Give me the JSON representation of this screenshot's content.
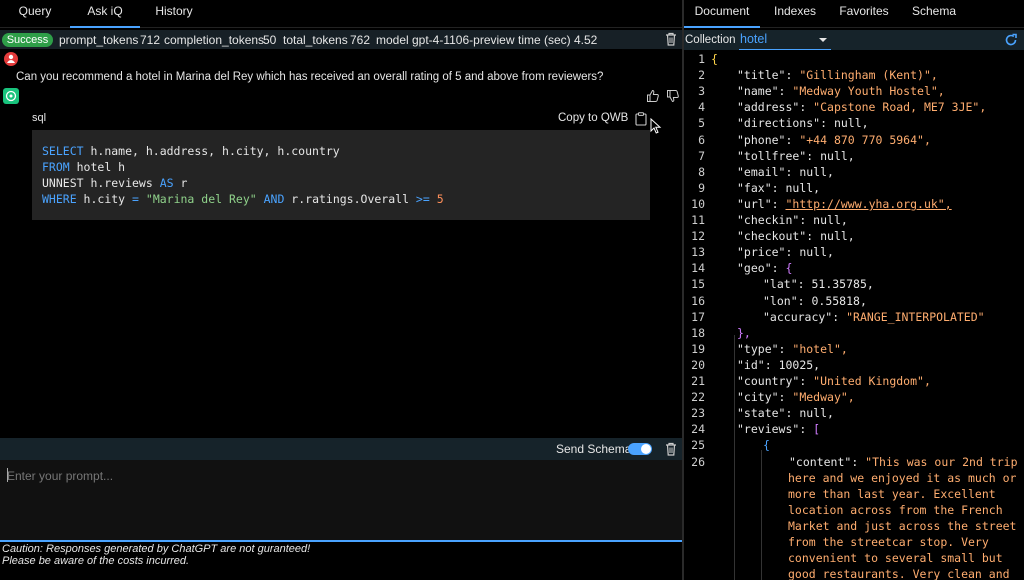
{
  "left_tabs": [
    "Query",
    "Ask iQ",
    "History"
  ],
  "status": {
    "badge": "Success",
    "prompt_tokens_label": "prompt_tokens",
    "prompt_tokens": "712",
    "completion_tokens_label": "completion_tokens",
    "completion_tokens": "50",
    "total_tokens_label": "total_tokens",
    "total_tokens": "762",
    "model_label": "model",
    "model": "gpt-4-1106-preview",
    "time_label": "time (sec)",
    "time": "4.52"
  },
  "chat": {
    "question": "Can you recommend a hotel in Marina del Rey which has received an overall rating of 5 and above from reviewers?",
    "code_lang": "sql",
    "copy_label": "Copy to QWB",
    "sql": {
      "l1_kw": "SELECT",
      "l1_rest": " h.name, h.address, h.city, h.country",
      "l2_kw": "FROM",
      "l2_rest": " hotel h",
      "l3_a": "UNNEST h.reviews ",
      "l3_kw": "AS",
      "l3_rest": " r",
      "l4_kw": "WHERE",
      "l4_a": " h.city ",
      "l4_eq": "=",
      "l4_str": "\"Marina del Rey\"",
      "l4_and": " AND ",
      "l4_b": "r.ratings.Overall ",
      "l4_ge": ">=",
      "l4_num": "5"
    }
  },
  "schema_toggle_label": "Send Schema",
  "prompt_placeholder": "Enter your prompt...",
  "caution_line1": "Caution: Responses generated by ChatGPT are not guranteed!",
  "caution_line2": "Please be aware of the costs incurred.",
  "right_tabs": [
    "Document",
    "Indexes",
    "Favorites",
    "Schema"
  ],
  "collection_label": "Collection",
  "collection_value": "hotel",
  "json_lines": [
    {
      "n": "1",
      "k": "",
      "v": "{"
    },
    {
      "n": "2",
      "k": "\"title\"",
      "v": "\"Gillingham (Kent)\","
    },
    {
      "n": "3",
      "k": "\"name\"",
      "v": "\"Medway Youth Hostel\","
    },
    {
      "n": "4",
      "k": "\"address\"",
      "v": "\"Capstone Road, ME7 3JE\","
    },
    {
      "n": "5",
      "k": "\"directions\"",
      "v": "null,"
    },
    {
      "n": "6",
      "k": "\"phone\"",
      "v": "\"+44 870 770 5964\","
    },
    {
      "n": "7",
      "k": "\"tollfree\"",
      "v": "null,"
    },
    {
      "n": "8",
      "k": "\"email\"",
      "v": "null,"
    },
    {
      "n": "9",
      "k": "\"fax\"",
      "v": "null,"
    },
    {
      "n": "10",
      "k": "\"url\"",
      "v": "\"http://www.yha.org.uk\","
    },
    {
      "n": "11",
      "k": "\"checkin\"",
      "v": "null,"
    },
    {
      "n": "12",
      "k": "\"checkout\"",
      "v": "null,"
    },
    {
      "n": "13",
      "k": "\"price\"",
      "v": "null,"
    },
    {
      "n": "14",
      "k": "\"geo\"",
      "v": "{"
    },
    {
      "n": "15",
      "k": "\"lat\"",
      "v": "51.35785,"
    },
    {
      "n": "16",
      "k": "\"lon\"",
      "v": "0.55818,"
    },
    {
      "n": "17",
      "k": "\"accuracy\"",
      "v": "\"RANGE_INTERPOLATED\""
    },
    {
      "n": "18",
      "k": "",
      "v": "},"
    },
    {
      "n": "19",
      "k": "\"type\"",
      "v": "\"hotel\","
    },
    {
      "n": "20",
      "k": "\"id\"",
      "v": "10025,"
    },
    {
      "n": "21",
      "k": "\"country\"",
      "v": "\"United Kingdom\","
    },
    {
      "n": "22",
      "k": "\"city\"",
      "v": "\"Medway\","
    },
    {
      "n": "23",
      "k": "\"state\"",
      "v": "null,"
    },
    {
      "n": "24",
      "k": "\"reviews\"",
      "v": "["
    },
    {
      "n": "25",
      "k": "",
      "v": "{"
    },
    {
      "n": "26",
      "k": "\"content\"",
      "v": "\"This was our 2nd trip"
    }
  ],
  "content_wrap": [
    "here and we enjoyed it as much or",
    "more than last year. Excellent",
    "location across from the French",
    "Market and just across the street",
    "from the streetcar stop. Very",
    "convenient to several small but",
    "good restaurants. Very clean and"
  ],
  "colors": {
    "accent": "#4aa3ff",
    "success": "#2e9e48",
    "string": "#ffad6f",
    "keyword": "#4aa3ff"
  },
  "icons": [
    "trash-icon",
    "thumbs-up-icon",
    "thumbs-down-icon",
    "clipboard-icon",
    "refresh-icon",
    "user-avatar-icon",
    "chatgpt-avatar-icon"
  ]
}
